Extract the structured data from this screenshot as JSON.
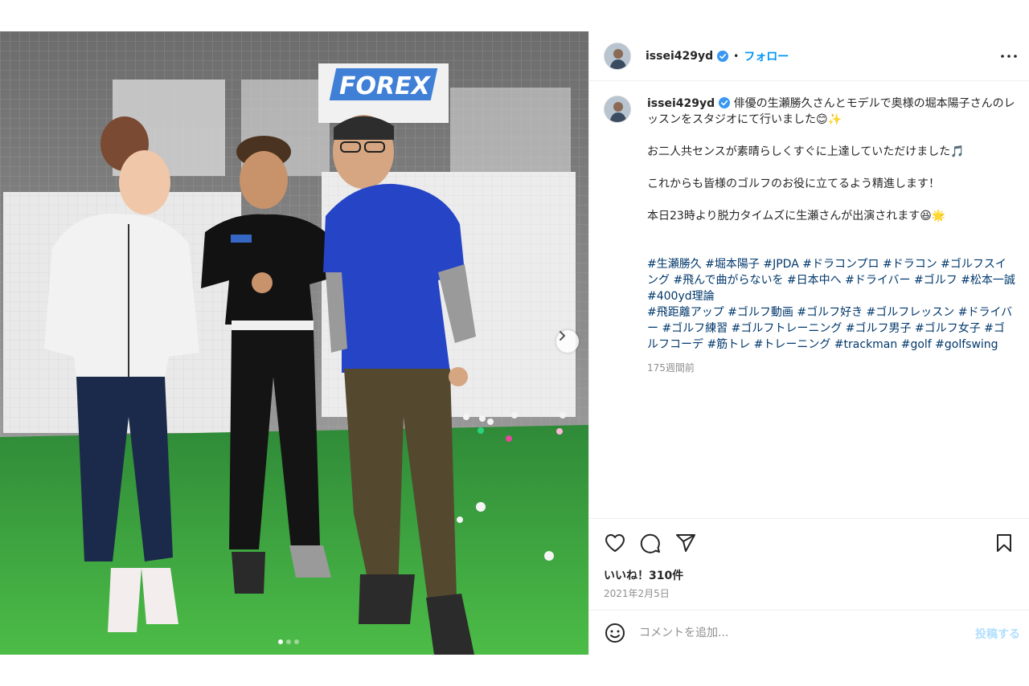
{
  "post": {
    "username": "issei429yd",
    "follow_label": "フォロー",
    "separator": "•",
    "more_icon": "more-horizontal-icon",
    "media": {
      "sign_text": "FOREX",
      "slide_count": 3,
      "active_slide": 1,
      "next_icon": "chevron-right-icon"
    },
    "caption": {
      "username": "issei429yd",
      "line1": "俳優の生瀬勝久さんとモデルで奥様の堀本陽子さんのレッスンをスタジオにて行いました😊✨",
      "line2": "お二人共センスが素晴らしくすぐに上達していただけました🎵",
      "line3": "これからも皆様のゴルフのお役に立てるよう精進します！",
      "line4": "本日23時より脱力タイムズに生瀬さんが出演されます😆🌟",
      "hashtags1": "#生瀬勝久 #堀本陽子 #JPDA #ドラコンプロ #ドラコン #ゴルフスイング #飛んで曲がらないを #日本中へ #ドライバー #ゴルフ #松本一誠 #400yd理論",
      "hashtags2": "#飛距離アップ #ゴルフ動画 #ゴルフ好き #ゴルフレッスン #ドライバー #ゴルフ練習 #ゴルフトレーニング #ゴルフ男子 #ゴルフ女子 #ゴルフコーデ #筋トレ #トレーニング #trackman #golf #golfswing",
      "time_ago": "175週間前"
    },
    "actions": {
      "like_icon": "heart-icon",
      "comment_icon": "comment-icon",
      "share_icon": "send-icon",
      "save_icon": "bookmark-icon"
    },
    "likes": "いいね！310件",
    "date": "2021年2月5日",
    "comment": {
      "placeholder": "コメントを追加...",
      "value": "",
      "post_label": "投稿する",
      "emoji_icon": "smiley-icon"
    },
    "colors": {
      "link": "#0095f6",
      "hashtag": "#00376b",
      "verified": "#3897f0",
      "muted": "#8e8e8e",
      "post_disabled": "#b2dffc"
    }
  }
}
